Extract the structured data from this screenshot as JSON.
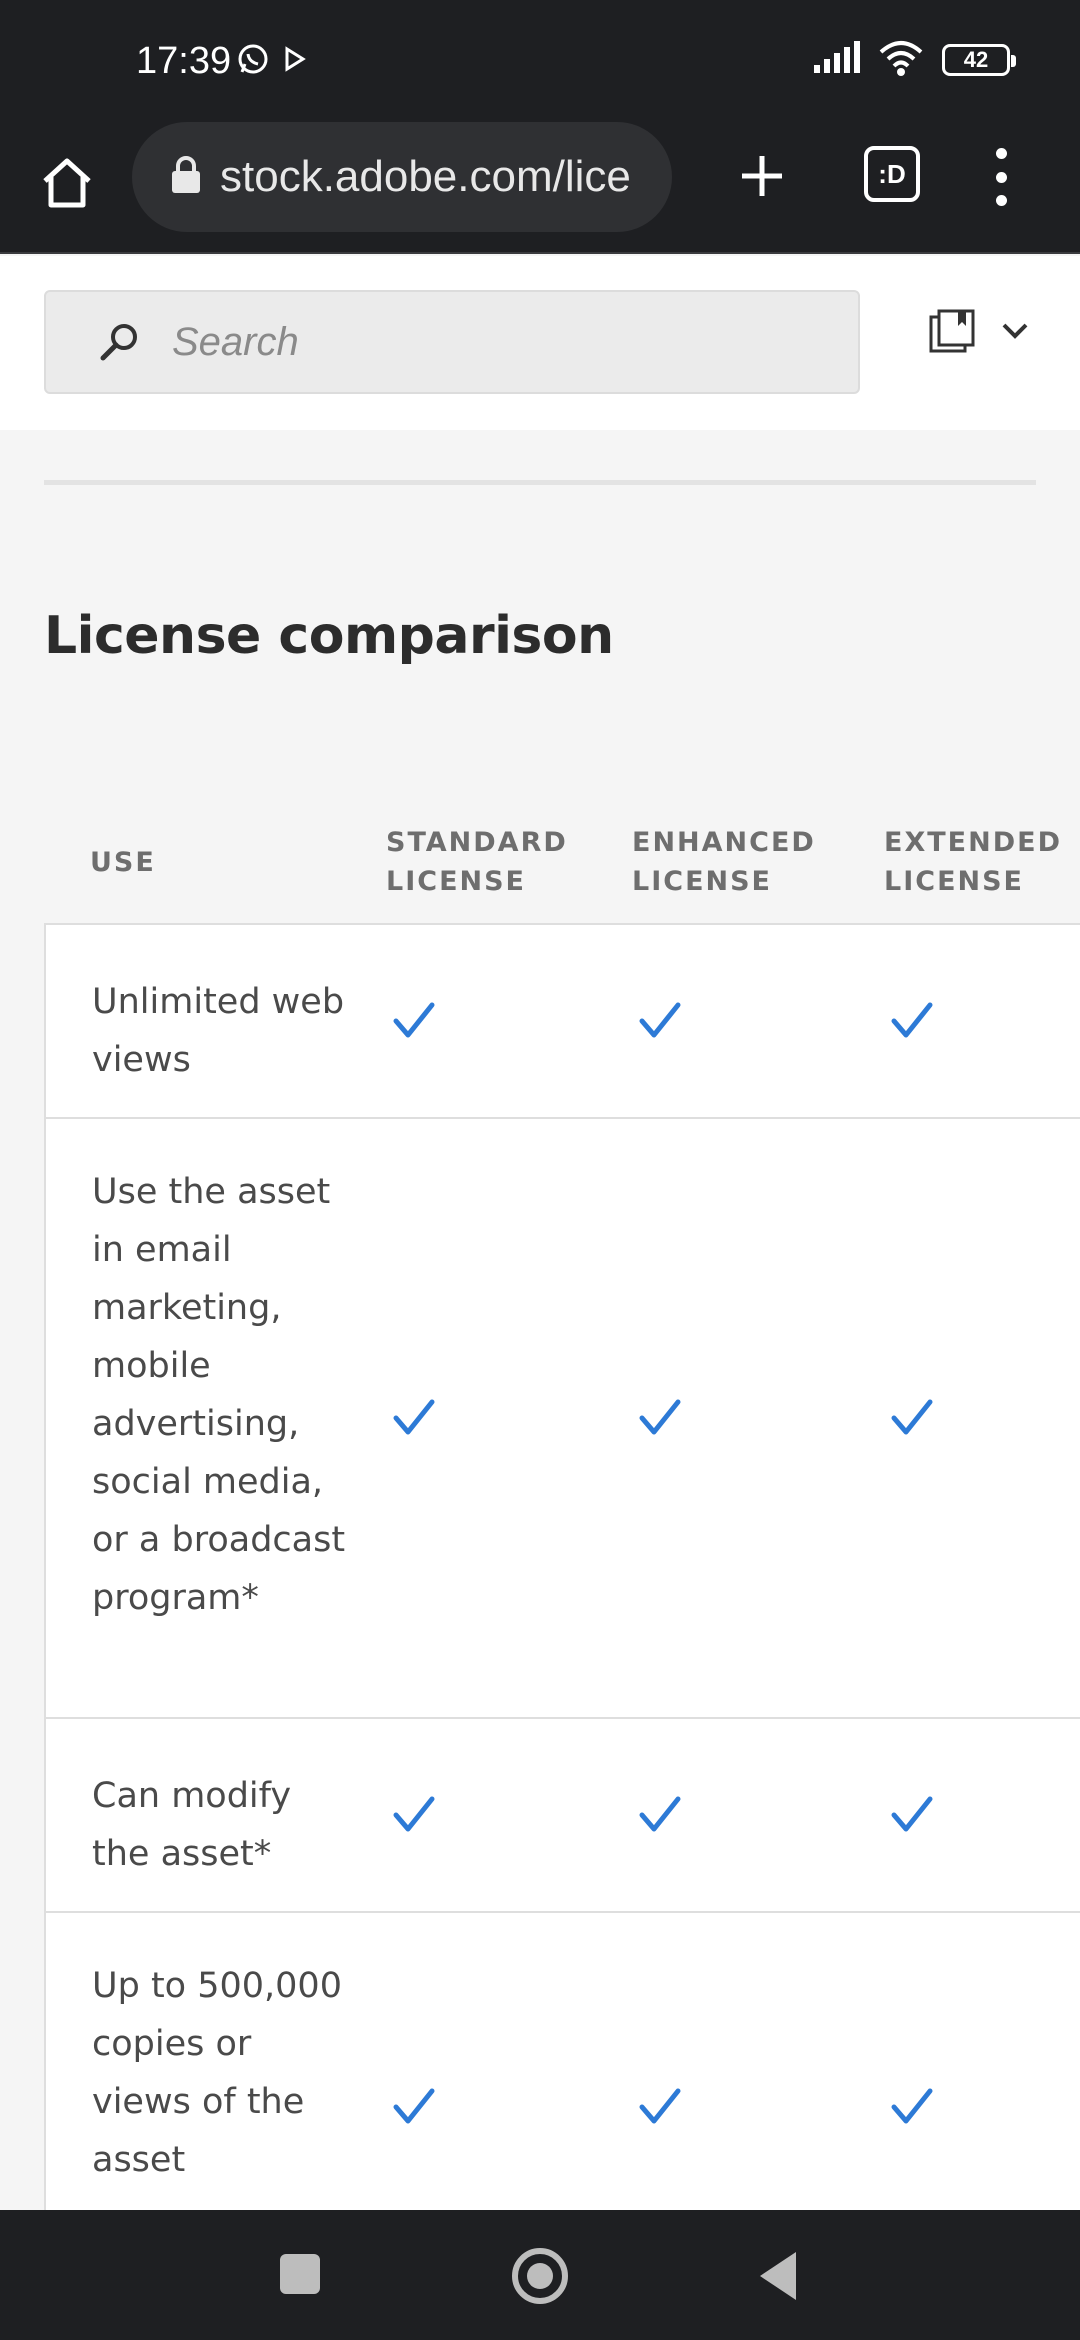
{
  "status_bar": {
    "time": "17:39",
    "battery": "42",
    "icons": [
      "whatsapp-icon",
      "play-icon",
      "signal-icon",
      "wifi-icon",
      "battery-icon"
    ]
  },
  "browser": {
    "url": "stock.adobe.com/lice",
    "tabs_label": ":D"
  },
  "search": {
    "placeholder": "Search"
  },
  "section": {
    "title": "License comparison"
  },
  "table": {
    "headers": {
      "use": "USE",
      "standard": "STANDARD LICENSE",
      "enhanced": "ENHANCED LICENSE",
      "extended": "EXTENDED LICENSE"
    },
    "rows": [
      {
        "use": "Unlimited web views",
        "standard": true,
        "enhanced": true,
        "extended": true
      },
      {
        "use": "Use the asset in email marketing, mobile advertising, social media, or a broadcast program*",
        "standard": true,
        "enhanced": true,
        "extended": true
      },
      {
        "use": "Can modify the asset*",
        "standard": true,
        "enhanced": true,
        "extended": true
      },
      {
        "use": "Up to 500,000 copies or views of the asset",
        "standard": true,
        "enhanced": true,
        "extended": true
      }
    ]
  },
  "colors": {
    "check": "#2d7ad6",
    "browser_bg": "#1e1f22"
  }
}
